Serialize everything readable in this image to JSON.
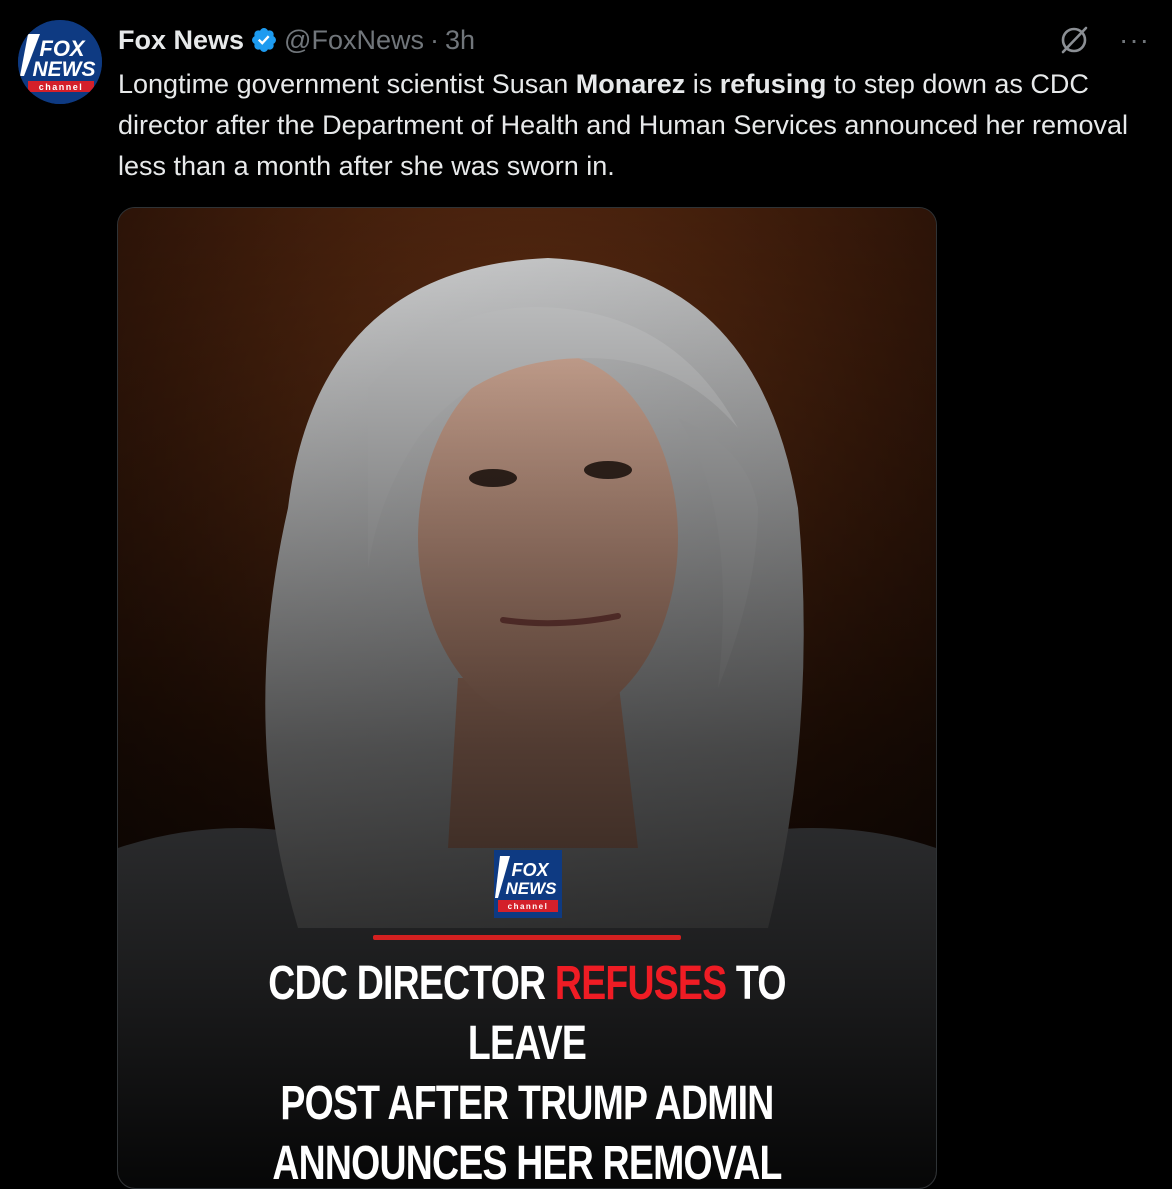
{
  "post": {
    "author": {
      "display_name": "Fox News",
      "handle": "@FoxNews",
      "separator": "·",
      "time": "3h",
      "verified": true,
      "avatar_logo": {
        "line1": "FOX",
        "line2": "NEWS",
        "line3": "channel"
      }
    },
    "text": {
      "part1": "Longtime government scientist Susan ",
      "bold1": "Monarez",
      "part2": " is ",
      "bold2": "refusing",
      "part3": " to step down as CDC director after the Department of Health and Human Services announced her removal less than a month after she was sworn in."
    },
    "media": {
      "logo": {
        "line1": "FOX",
        "line2": "NEWS",
        "line3": "channel"
      },
      "headline": {
        "before": "CDC DIRECTOR ",
        "highlight": "REFUSES",
        "after_line1": " TO LEAVE",
        "line2": "POST AFTER TRUMP ADMIN",
        "line3": "ANNOUNCES HER REMOVAL"
      }
    },
    "icons": {
      "grok": "grok-icon",
      "more": "more-icon",
      "verified": "verified-badge-icon"
    },
    "more_label": "···"
  },
  "colors": {
    "background": "#000000",
    "text_primary": "#e7e9ea",
    "text_secondary": "#71767b",
    "verified_blue": "#1d9bf0",
    "headline_red": "#ef1c24",
    "rule_red": "#d42020"
  }
}
